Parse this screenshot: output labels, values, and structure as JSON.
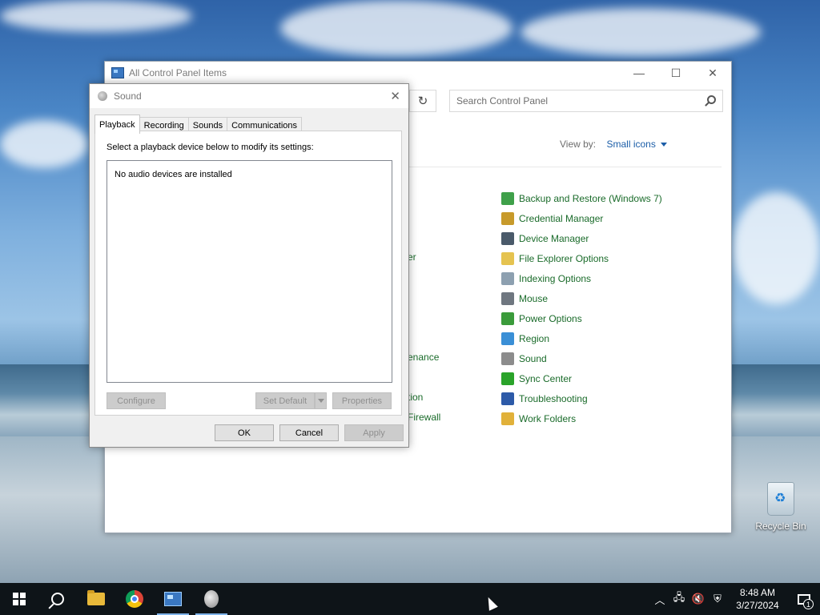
{
  "control_panel": {
    "title": "All Control Panel Items",
    "search_placeholder": "Search Control Panel",
    "view_by_label": "View by:",
    "view_by_value": "Small icons",
    "items": [
      {
        "label": "Backup and Restore (Windows 7)",
        "icon": "backup-restore-icon",
        "color": "#3fa04a"
      },
      {
        "label": "Credential Manager",
        "icon": "credential-manager-icon",
        "color": "#c79a2b"
      },
      {
        "label": "Device Manager",
        "icon": "device-manager-icon",
        "color": "#4a5a6a"
      },
      {
        "label": "File Explorer Options",
        "icon": "folder-options-icon",
        "color": "#e5c350"
      },
      {
        "label": "Indexing Options",
        "icon": "indexing-options-icon",
        "color": "#8da0b0"
      },
      {
        "label": "Mouse",
        "icon": "mouse-icon",
        "color": "#6f7780"
      },
      {
        "label": "Power Options",
        "icon": "power-options-icon",
        "color": "#3b9b3b"
      },
      {
        "label": "Region",
        "icon": "region-icon",
        "color": "#3a8fd6"
      },
      {
        "label": "Sound",
        "icon": "speaker-icon",
        "color": "#8c8c8c"
      },
      {
        "label": "Sync Center",
        "icon": "sync-center-icon",
        "color": "#2aa32a"
      },
      {
        "label": "Troubleshooting",
        "icon": "troubleshooting-icon",
        "color": "#2d5aa8"
      },
      {
        "label": "Work Folders",
        "icon": "work-folders-icon",
        "color": "#e1b13a"
      }
    ],
    "partial_items": [
      "er",
      "enance",
      "tion",
      "Firewall"
    ]
  },
  "sound_dialog": {
    "title": "Sound",
    "tabs": [
      "Playback",
      "Recording",
      "Sounds",
      "Communications"
    ],
    "active_tab": "Playback",
    "instruction": "Select a playback device below to modify its settings:",
    "empty_message": "No audio devices are installed",
    "configure_label": "Configure",
    "set_default_label": "Set Default",
    "properties_label": "Properties",
    "ok_label": "OK",
    "cancel_label": "Cancel",
    "apply_label": "Apply"
  },
  "desktop": {
    "recycle_bin_label": "Recycle Bin"
  },
  "taskbar": {
    "time": "8:48 AM",
    "date": "3/27/2024",
    "notification_count": "1"
  }
}
